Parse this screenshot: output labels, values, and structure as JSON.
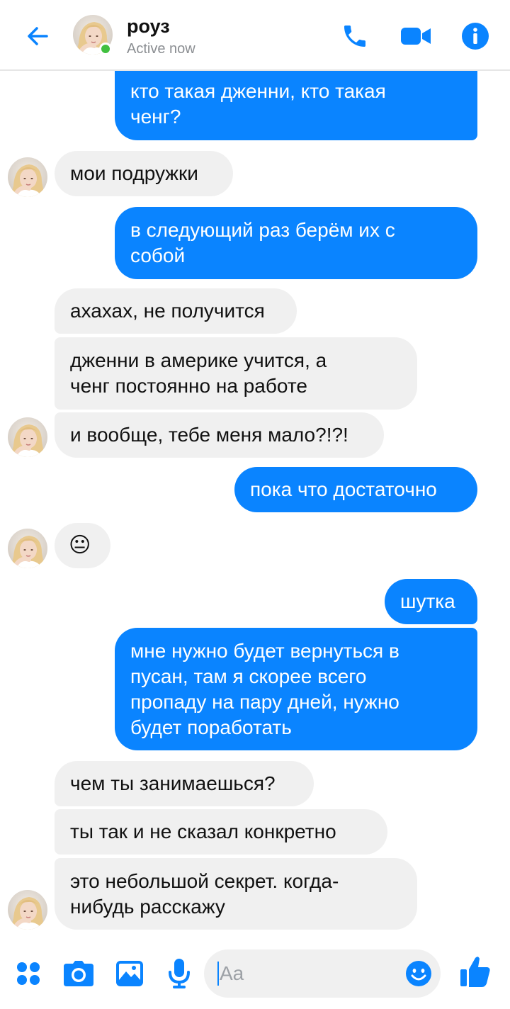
{
  "header": {
    "contact_name": "роуз",
    "status": "Active now"
  },
  "messages": [
    {
      "dir": "out",
      "text": "кто такая дженни, кто такая\nченг?"
    },
    {
      "dir": "in",
      "text": "мои подружки"
    },
    {
      "dir": "out",
      "text": "в следующий раз берём их с\nсобой"
    },
    {
      "dir": "in",
      "text": "ахахах, не получится"
    },
    {
      "dir": "in",
      "text": "дженни в америке учится, а\nченг постоянно на работе"
    },
    {
      "dir": "in",
      "text": "и вообще, тебе меня мало?!?!"
    },
    {
      "dir": "out",
      "text": "пока что достаточно"
    },
    {
      "dir": "in",
      "text": "😐"
    },
    {
      "dir": "out",
      "text": "шутка"
    },
    {
      "dir": "out",
      "text": "мне нужно будет вернуться в\nпусан, там я скорее всего\nпропаду на пару дней, нужно\nбудет поработать"
    },
    {
      "dir": "in",
      "text": "чем ты занимаешься?"
    },
    {
      "dir": "in",
      "text": "ты так и не сказал конкретно"
    },
    {
      "dir": "in",
      "text": "это небольшой секрет. когда-\nнибудь расскажу"
    }
  ],
  "composer": {
    "placeholder": "Aa"
  },
  "icons": {
    "back": "back-arrow-icon",
    "call": "phone-icon",
    "video": "video-camera-icon",
    "info": "info-icon",
    "menu": "four-dots-icon",
    "camera": "camera-icon",
    "gallery": "image-icon",
    "mic": "microphone-icon",
    "emoji": "emoji-icon",
    "like": "thumbs-up-icon"
  },
  "colors": {
    "accent": "#0a84ff",
    "incoming_bubble": "#f0f0f0",
    "online": "#41c03f"
  }
}
